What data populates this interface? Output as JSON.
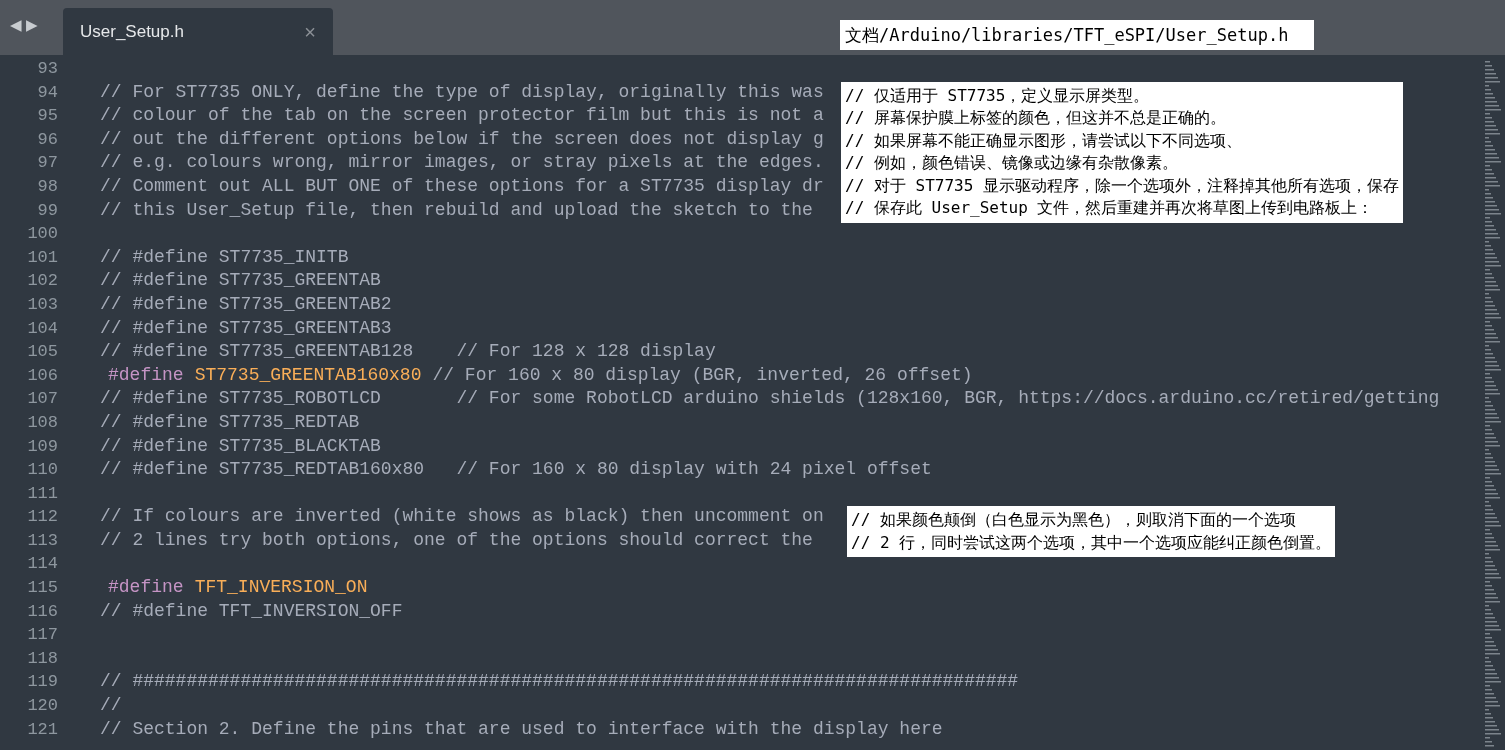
{
  "tab_bar": {
    "nav_back": "◀",
    "nav_forward": "▶",
    "tabs": [
      {
        "title": "User_Setup.h",
        "close": "×",
        "selected": true
      }
    ]
  },
  "path_note": "文档/Arduino/libraries/TFT_eSPI/User_Setup.h",
  "lines": [
    {
      "number": "93"
    },
    {
      "number": "94",
      "segments": [
        {
          "kind": "comment",
          "text": "// For ST7735 ONLY, define the type of display, originally this was"
        }
      ]
    },
    {
      "number": "95",
      "segments": [
        {
          "kind": "comment",
          "text": "// colour of the tab on the screen protector film but this is not a"
        }
      ]
    },
    {
      "number": "96",
      "segments": [
        {
          "kind": "comment",
          "text": "// out the different options below if the screen does not display g"
        }
      ]
    },
    {
      "number": "97",
      "segments": [
        {
          "kind": "comment",
          "text": "// e.g. colours wrong, mirror images, or stray pixels at the edges."
        }
      ]
    },
    {
      "number": "98",
      "segments": [
        {
          "kind": "comment",
          "text": "// Comment out ALL BUT ONE of these options for a ST7735 display dr"
        }
      ]
    },
    {
      "number": "99",
      "segments": [
        {
          "kind": "comment",
          "text": "// this User_Setup file, then rebuild and upload the sketch to the"
        }
      ]
    },
    {
      "number": "100"
    },
    {
      "number": "101",
      "segments": [
        {
          "kind": "comment",
          "text": "// #define ST7735_INITB"
        }
      ]
    },
    {
      "number": "102",
      "segments": [
        {
          "kind": "comment",
          "text": "// #define ST7735_GREENTAB"
        }
      ]
    },
    {
      "number": "103",
      "segments": [
        {
          "kind": "comment",
          "text": "// #define ST7735_GREENTAB2"
        }
      ]
    },
    {
      "number": "104",
      "segments": [
        {
          "kind": "comment",
          "text": "// #define ST7735_GREENTAB3"
        }
      ]
    },
    {
      "number": "105",
      "segments": [
        {
          "kind": "comment",
          "text": "// #define ST7735_GREENTAB128    // For 128 x 128 display"
        }
      ]
    },
    {
      "number": "106",
      "segments": [
        {
          "kind": "keyword",
          "text": "#define"
        },
        {
          "kind": "macro",
          "text": "ST7735_GREENTAB160x80"
        },
        {
          "kind": "comment",
          "text": "// For 160 x 80 display (BGR, inverted, 26 offset)"
        }
      ]
    },
    {
      "number": "107",
      "segments": [
        {
          "kind": "comment",
          "text": "// #define ST7735_ROBOTLCD       // For some RobotLCD arduino shields (128x160, BGR, https://docs.arduino.cc/retired/getting"
        }
      ]
    },
    {
      "number": "108",
      "segments": [
        {
          "kind": "comment",
          "text": "// #define ST7735_REDTAB"
        }
      ]
    },
    {
      "number": "109",
      "segments": [
        {
          "kind": "comment",
          "text": "// #define ST7735_BLACKTAB"
        }
      ]
    },
    {
      "number": "110",
      "segments": [
        {
          "kind": "comment",
          "text": "// #define ST7735_REDTAB160x80   // For 160 x 80 display with 24 pixel offset"
        }
      ]
    },
    {
      "number": "111"
    },
    {
      "number": "112",
      "segments": [
        {
          "kind": "comment",
          "text": "// If colours are inverted (white shows as black) then uncomment on"
        }
      ]
    },
    {
      "number": "113",
      "segments": [
        {
          "kind": "comment",
          "text": "// 2 lines try both options, one of the options should correct the"
        }
      ]
    },
    {
      "number": "114"
    },
    {
      "number": "115",
      "segments": [
        {
          "kind": "keyword",
          "text": "#define"
        },
        {
          "kind": "macro",
          "text": "TFT_INVERSION_ON"
        }
      ]
    },
    {
      "number": "116",
      "segments": [
        {
          "kind": "comment",
          "text": "// #define TFT_INVERSION_OFF"
        }
      ]
    },
    {
      "number": "117"
    },
    {
      "number": "118"
    },
    {
      "number": "119",
      "segments": [
        {
          "kind": "comment",
          "text": "// ##################################################################################"
        }
      ]
    },
    {
      "number": "120",
      "segments": [
        {
          "kind": "comment",
          "text": "//"
        }
      ]
    },
    {
      "number": "121",
      "segments": [
        {
          "kind": "comment",
          "text": "// Section 2. Define the pins that are used to interface with the display here"
        }
      ]
    }
  ],
  "notes": [
    {
      "lines": [
        "// 仅适用于 ST7735，定义显示屏类型。",
        "// 屏幕保护膜上标签的颜色，但这并不总是正确的。",
        "// 如果屏幕不能正确显示图形，请尝试以下不同选项、",
        "// 例如，颜色错误、镜像或边缘有杂散像素。",
        "// 对于 ST7735 显示驱动程序，除一个选项外，注释掉其他所有选项，保存",
        "// 保存此 User_Setup 文件，然后重建并再次将草图上传到电路板上："
      ]
    },
    {
      "lines": [
        "// 如果颜色颠倒（白色显示为黑色），则取消下面的一个选项",
        "// 2 行，同时尝试这两个选项，其中一个选项应能纠正颜色倒置。"
      ]
    }
  ]
}
